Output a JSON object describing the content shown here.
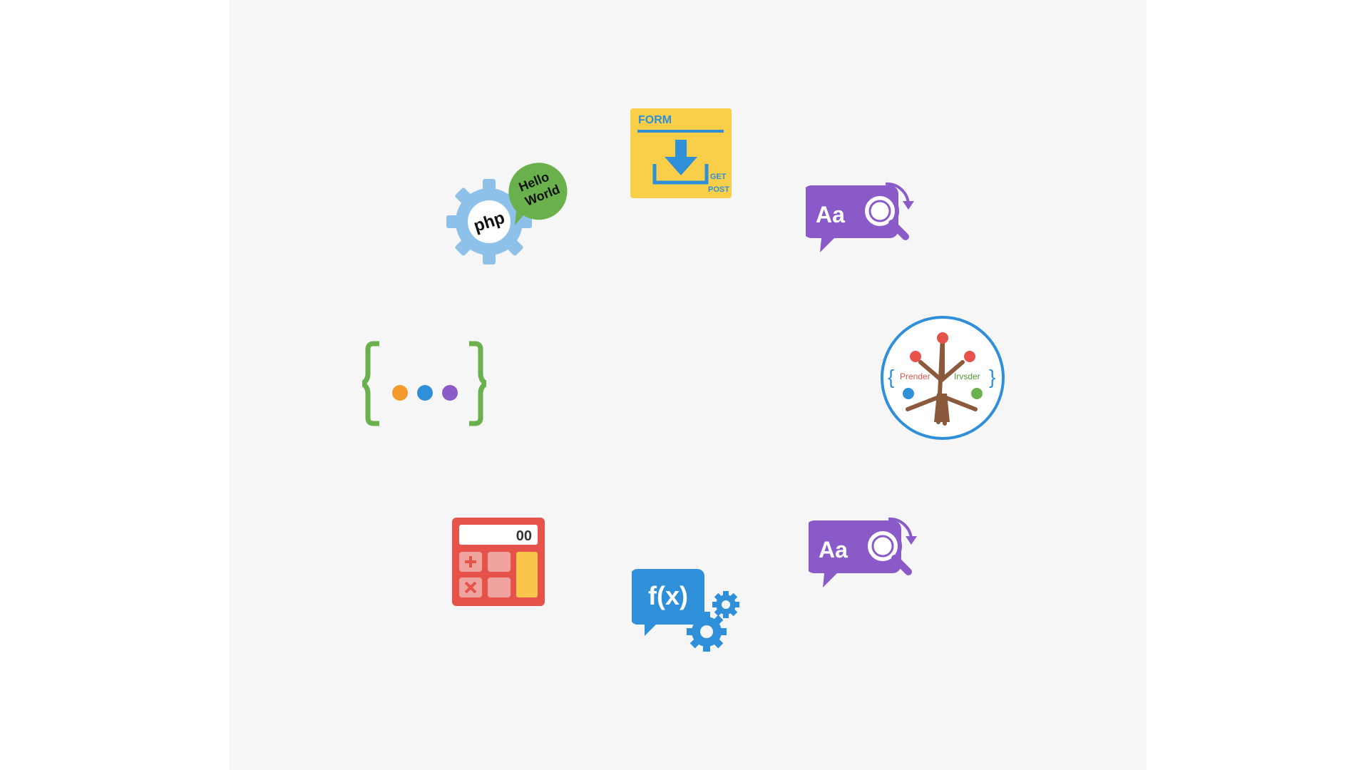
{
  "colors": {
    "background": "#ffffff",
    "card": "#f6f6f6",
    "php_gear": "#8ec1ea",
    "hello_bubble": "#6ab04c",
    "form_yellow": "#f9cf4a",
    "form_blue": "#2f8fd8",
    "search_purple": "#8a5ac8",
    "brace_green": "#6ab04c",
    "dot_orange": "#f39a2b",
    "dot_blue": "#2f8fd8",
    "dot_purple": "#8a5ac8",
    "tree_ring": "#2f8fd8",
    "tree_trunk": "#8b5a3c",
    "calc_red": "#e5534b",
    "func_blue": "#2f8fd8"
  },
  "icons": {
    "php": {
      "label": "php",
      "bubble_line1": "Hello",
      "bubble_line2": "World"
    },
    "form": {
      "title": "FORM",
      "method1": "GET",
      "method2": "POST"
    },
    "search_top": {
      "label": "Aa"
    },
    "search_bottom": {
      "label": "Aa"
    },
    "tree": {
      "left_label": "Prender",
      "right_label": "Irvsder"
    },
    "calculator": {
      "display": "00"
    },
    "function": {
      "label": "f(x)"
    }
  }
}
